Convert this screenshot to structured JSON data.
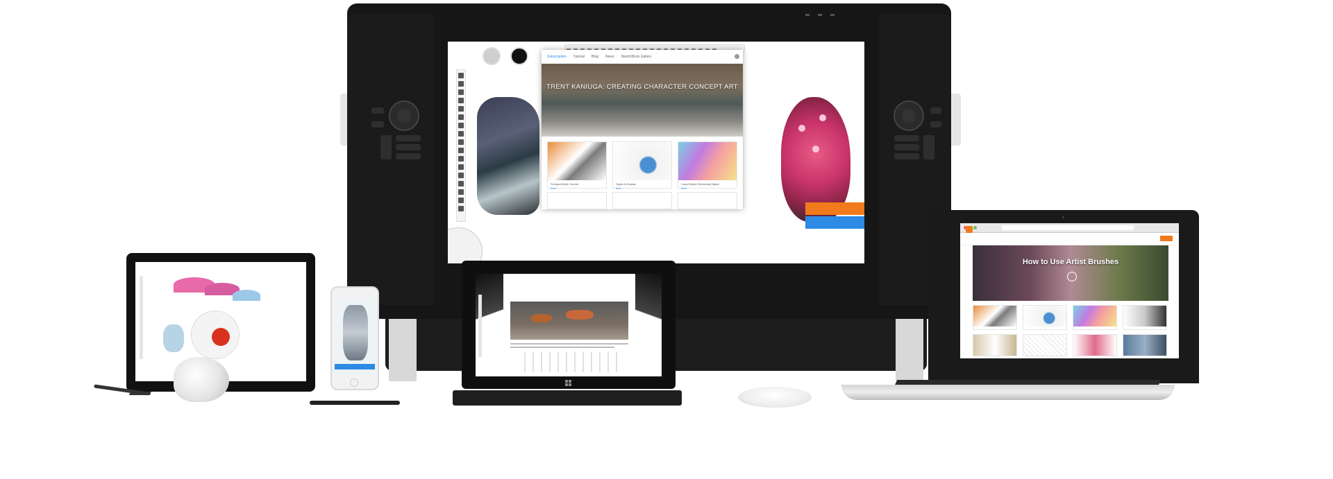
{
  "cintiq_site": {
    "nav": [
      "Subscription",
      "Tutorial",
      "Blog",
      "News",
      "SketchBook Gallery"
    ],
    "hero_title": "TRENT KANIUGA: CREATING CHARACTER CONCEPT ART",
    "cards": [
      {
        "caption": "Ferrigan/Wells Tutorial",
        "link": "More"
      },
      {
        "caption": "Sigrid Al-Sukkar...",
        "link": "More"
      },
      {
        "caption": "Copic/Sketch Sketching Digital",
        "link": "More"
      }
    ]
  },
  "macbook_site": {
    "hero_title": "How to Use Artist Brushes"
  },
  "colors": {
    "accent_blue": "#2d8ae5",
    "accent_orange": "#f07a1c"
  }
}
